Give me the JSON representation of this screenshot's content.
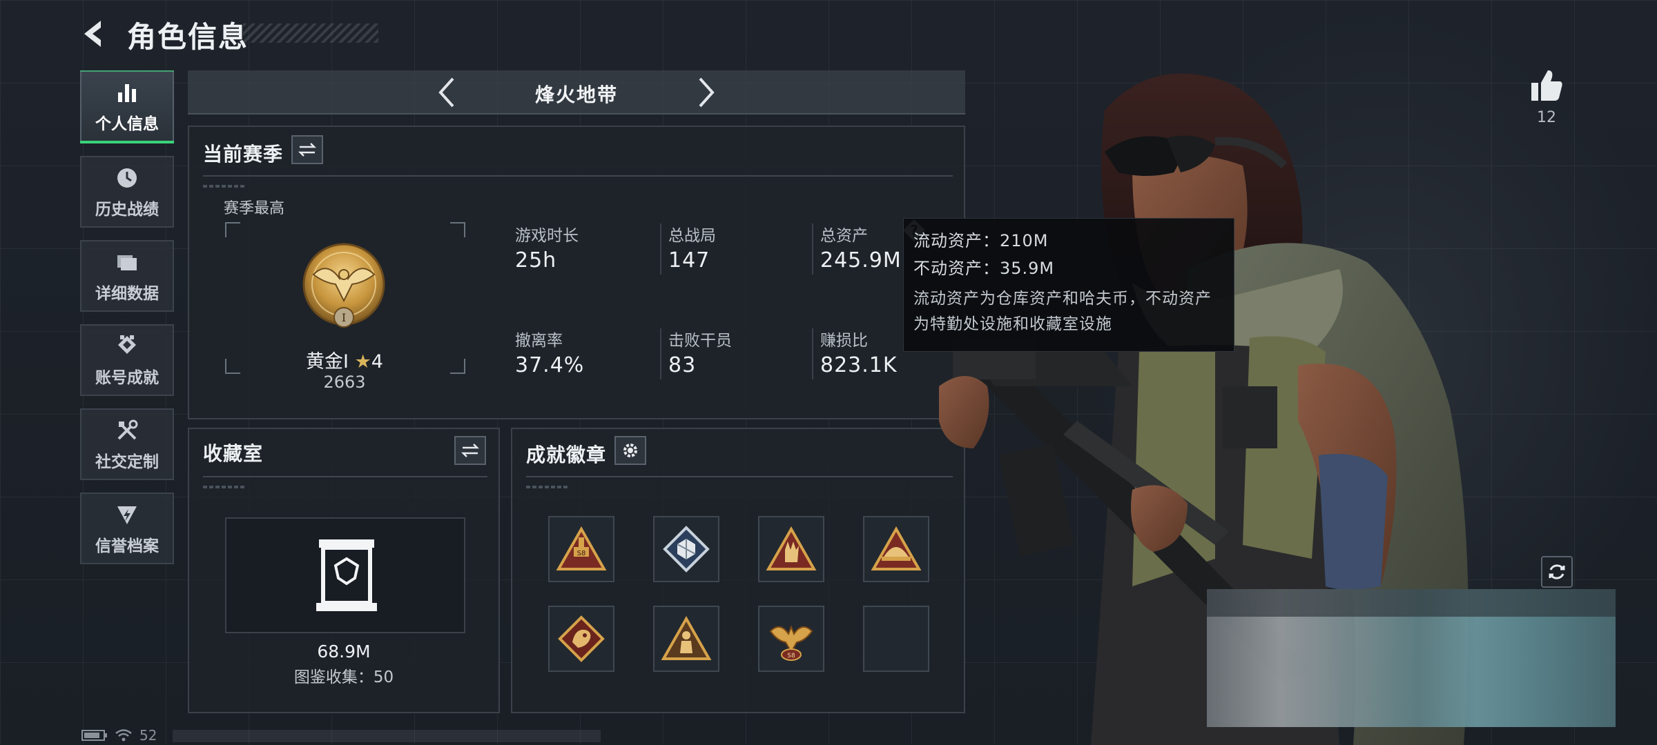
{
  "header": {
    "title": "角色信息"
  },
  "sidebar": {
    "items": [
      {
        "label": "个人信息",
        "icon": "bar-chart-icon",
        "active": true
      },
      {
        "label": "历史战绩",
        "icon": "history-clock-icon",
        "active": false
      },
      {
        "label": "详细数据",
        "icon": "folder-icon",
        "active": false
      },
      {
        "label": "账号成就",
        "icon": "achievement-icon",
        "active": false
      },
      {
        "label": "社交定制",
        "icon": "tools-icon",
        "active": false
      },
      {
        "label": "信誉档案",
        "icon": "credit-shield-icon",
        "active": false
      }
    ]
  },
  "mode": {
    "title": "烽火地带"
  },
  "season": {
    "title": "当前赛季",
    "best_label": "赛季最高",
    "rank_name": "黄金Ⅰ",
    "rank_stars": "4",
    "rank_score": "2663",
    "stats": [
      {
        "label": "游戏时长",
        "value": "25h"
      },
      {
        "label": "总战局",
        "value": "147"
      },
      {
        "label": "总资产",
        "value": "245.9M"
      },
      {
        "label": "撤离率",
        "value": "37.4%"
      },
      {
        "label": "击败干员",
        "value": "83"
      },
      {
        "label": "赚损比",
        "value": "823.1K"
      }
    ]
  },
  "tooltip": {
    "liquid": "流动资产：210M",
    "fixed": "不动资产：35.9M",
    "desc_line1": "流动资产为仓库资产和哈夫币，不动资产",
    "desc_line2": "为特勤处设施和收藏室设施"
  },
  "collection": {
    "title": "收藏室",
    "value": "68.9M",
    "catalog": "图鉴收集：50"
  },
  "badges": {
    "title": "成就徽章",
    "items": [
      {
        "icon": "badge-s8-icon"
      },
      {
        "icon": "badge-cube-icon"
      },
      {
        "icon": "badge-hand-icon"
      },
      {
        "icon": "badge-helmet-icon"
      },
      {
        "icon": "badge-dragon-icon"
      },
      {
        "icon": "badge-soldier-icon"
      },
      {
        "icon": "badge-eagle-s8-icon"
      },
      {
        "icon": "empty"
      }
    ]
  },
  "likes": {
    "count": "12"
  },
  "status": {
    "time": "52"
  },
  "colors": {
    "accent": "#3bd17b",
    "badge_gold": "#d6a24a",
    "badge_red": "#7a2a22"
  }
}
